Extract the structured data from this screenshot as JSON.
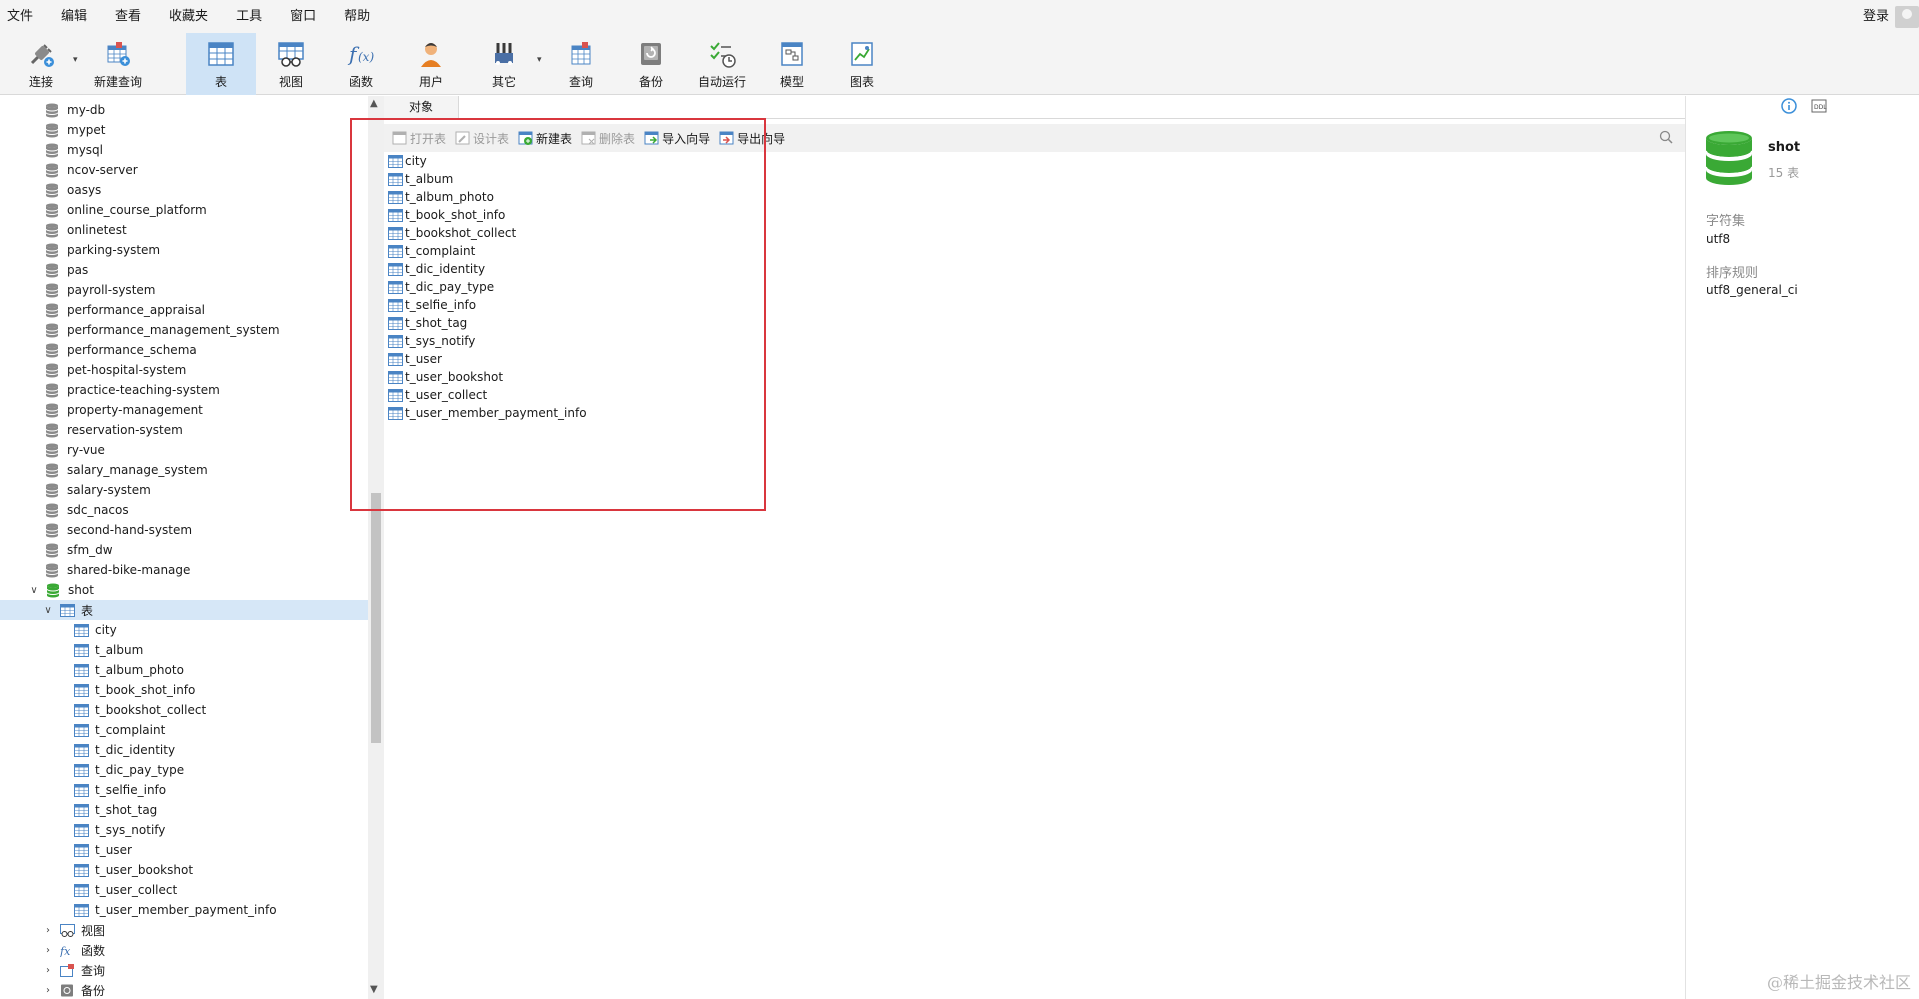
{
  "menu": [
    "文件",
    "编辑",
    "查看",
    "收藏夹",
    "工具",
    "窗口",
    "帮助"
  ],
  "login_label": "登录",
  "toolbar": {
    "connect": "连接",
    "new_query": "新建查询",
    "table": "表",
    "view": "视图",
    "function": "函数",
    "user": "用户",
    "other": "其它",
    "query": "查询",
    "backup": "备份",
    "auto_run": "自动运行",
    "model": "模型",
    "chart": "图表"
  },
  "tree": {
    "databases": [
      "my-db",
      "mypet",
      "mysql",
      "ncov-server",
      "oasys",
      "online_course_platform",
      "onlinetest",
      "parking-system",
      "pas",
      "payroll-system",
      "performance_appraisal",
      "performance_management_system",
      "performance_schema",
      "pet-hospital-system",
      "practice-teaching-system",
      "property-management",
      "reservation-system",
      "ry-vue",
      "salary_manage_system",
      "salary-system",
      "sdc_nacos",
      "second-hand-system",
      "sfm_dw",
      "shared-bike-manage"
    ],
    "open_db": "shot",
    "tables_node": "表",
    "tables": [
      "city",
      "t_album",
      "t_album_photo",
      "t_book_shot_info",
      "t_bookshot_collect",
      "t_complaint",
      "t_dic_identity",
      "t_dic_pay_type",
      "t_selfie_info",
      "t_shot_tag",
      "t_sys_notify",
      "t_user",
      "t_user_bookshot",
      "t_user_collect",
      "t_user_member_payment_info"
    ],
    "views_node": "视图",
    "functions_node": "函数",
    "queries_node": "查询",
    "backups_node": "备份"
  },
  "objects": {
    "tab_label": "对象",
    "tools": {
      "open_table": "打开表",
      "design_table": "设计表",
      "new_table": "新建表",
      "delete_table": "删除表",
      "import_wizard": "导入向导",
      "export_wizard": "导出向导"
    },
    "items": [
      "city",
      "t_album",
      "t_album_photo",
      "t_book_shot_info",
      "t_bookshot_collect",
      "t_complaint",
      "t_dic_identity",
      "t_dic_pay_type",
      "t_selfie_info",
      "t_shot_tag",
      "t_sys_notify",
      "t_user",
      "t_user_bookshot",
      "t_user_collect",
      "t_user_member_payment_info"
    ]
  },
  "info_panel": {
    "db_name": "shot",
    "table_count": "15 表",
    "charset_label": "字符集",
    "charset_value": "utf8",
    "collation_label": "排序规则",
    "collation_value": "utf8_general_ci"
  },
  "watermark": "@稀土掘金技术社区",
  "colors": {
    "db_open": "#3aa935",
    "db_closed": "#8a8a8a",
    "active_tool": "#cfe3f6",
    "highlight_box": "#d9363e",
    "table_icon": "#4a84c4"
  }
}
